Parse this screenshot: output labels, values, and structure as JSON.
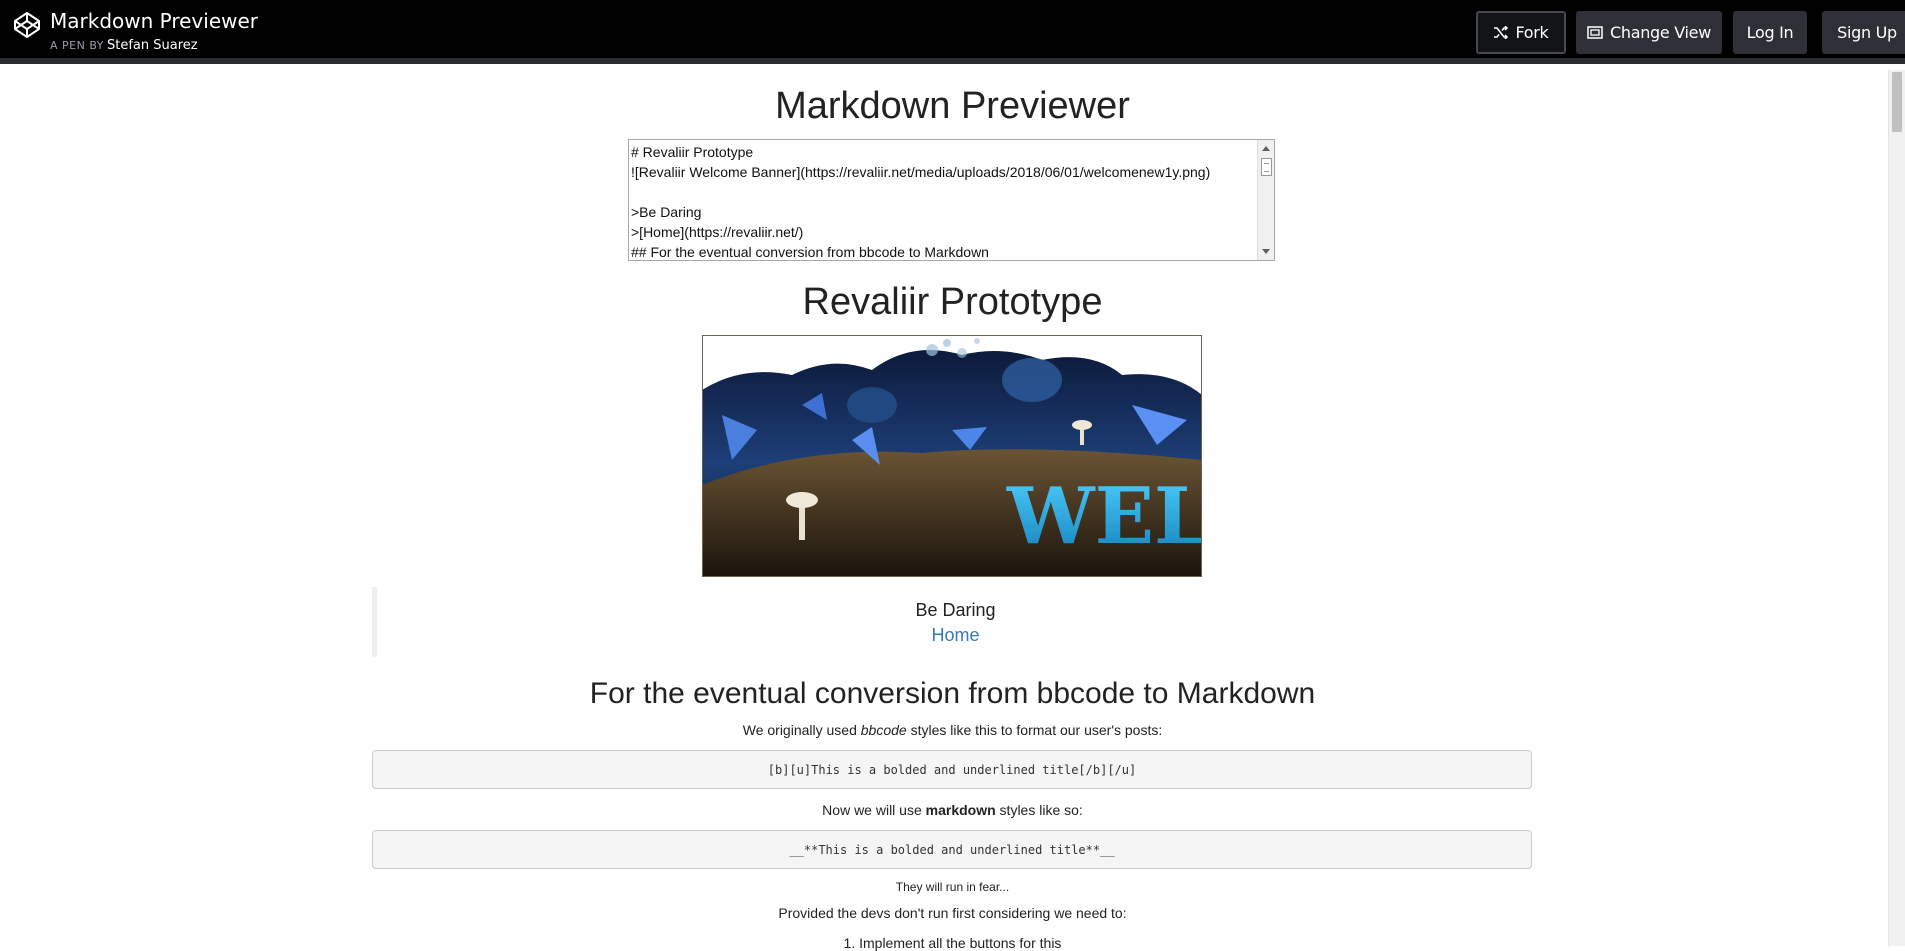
{
  "header": {
    "title": "Markdown Previewer",
    "by_prefix": "A PEN BY",
    "author": "Stefan Suarez",
    "buttons": {
      "fork": "Fork",
      "change_view": "Change View",
      "login": "Log In",
      "signup": "Sign Up"
    }
  },
  "page": {
    "title": "Markdown Previewer"
  },
  "editor": {
    "lines": [
      "# Revaliir Prototype",
      "![Revaliir Welcome Banner](https://revaliir.net/media/uploads/2018/06/01/welcomenew1y.png)",
      "",
      ">Be Daring",
      ">[Home](https://revaliir.net/)",
      "## For the eventual conversion from bbcode to Markdown"
    ]
  },
  "preview": {
    "h1": "Revaliir Prototype",
    "banner_text": "WELCOME",
    "quote_text": "Be Daring",
    "quote_link": "Home",
    "h2": "For the eventual conversion from bbcode to Markdown",
    "para1": {
      "before": "We originally used ",
      "em": "bbcode",
      "after": " styles like this to format our user's posts:"
    },
    "code1": "[b][u]This is a bolded and underlined title[/b][/u]",
    "para2": {
      "before": "Now we will use ",
      "strong": "markdown",
      "after": " styles like so:"
    },
    "code2": "__**This is a bolded and underlined title**__",
    "small": "They will run in fear...",
    "para3": "Provided the devs don't run first considering we need to:",
    "list_item_1": "1. Implement all the buttons for this"
  },
  "colors": {
    "topbar": "#000000",
    "link": "#337ab7",
    "code_bg": "#f5f5f5"
  }
}
